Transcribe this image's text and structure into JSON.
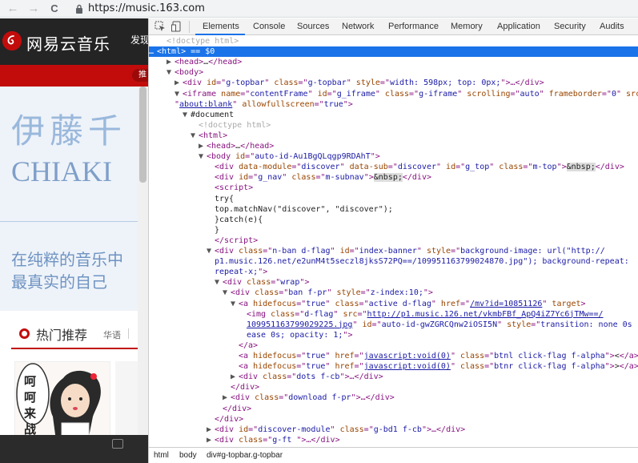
{
  "browser": {
    "url": "https://music.163.com",
    "back_icon": "←",
    "forward_icon": "→",
    "reload_icon": "C"
  },
  "site": {
    "logo_text": "网易云音乐",
    "nav_partial": "发现",
    "subnav_partial": "推",
    "banner_name": "伊藤千",
    "banner_en": "CHIAKI",
    "banner_slogan_1": "在纯粹的音乐中",
    "banner_slogan_2": "最真实的自己",
    "hot_title": "热门推荐",
    "hot_tag": "华语",
    "comic_text": "呵呵来战"
  },
  "devtools": {
    "tabs": [
      "Elements",
      "Console",
      "Sources",
      "Network",
      "Performance",
      "Memory",
      "Application",
      "Security",
      "Audits"
    ],
    "active_tab": "Elements",
    "breadcrumbs": [
      "html",
      "body",
      "div#g-topbar.g-topbar"
    ]
  },
  "dom_lines": [
    {
      "indent": 0,
      "tri": "",
      "cls": "cm",
      "text": "<!doctype html>"
    },
    {
      "indent": 0,
      "tri": "…",
      "cls": "sel",
      "text": "<html> == $0"
    },
    {
      "indent": 1,
      "tri": "▶",
      "html": "<span class='tag'>&lt;head&gt;</span><span class='txt'>…</span><span class='tag'>&lt;/head&gt;</span>"
    },
    {
      "indent": 1,
      "tri": "▼",
      "html": "<span class='tag'>&lt;body&gt;</span>"
    },
    {
      "indent": 2,
      "tri": "▶",
      "html": "<span class='tag'>&lt;div </span><span class='an'>id</span>=\"<span class='av'>g-topbar</span>\" <span class='an'>class</span>=\"<span class='av'>g-topbar</span>\" <span class='an'>style</span>=\"<span class='av'>width: 598px; top: 0px;</span>\"<span class='tag'>&gt;</span>…<span class='tag'>&lt;/div&gt;</span>"
    },
    {
      "indent": 2,
      "tri": "▼",
      "html": "<span class='tag'>&lt;iframe </span><span class='an'>name</span>=\"<span class='av'>contentFrame</span>\" <span class='an'>id</span>=\"<span class='av'>g_iframe</span>\" <span class='an'>class</span>=\"<span class='av'>g-iframe</span>\" <span class='an'>scrolling</span>=\"<span class='av'>auto</span>\" <span class='an'>frameborder</span>=\"<span class='av'>0</span>\" <span class='an'>src</span>="
    },
    {
      "indent": 0,
      "tri": "",
      "html": "\"<span class='lnk'>about:blank</span>\" <span class='an'>allowfullscreen</span>=\"<span class='av'>true</span>\"<span class='tag'>&gt;</span>"
    },
    {
      "indent": 3,
      "tri": "▼",
      "html": "<span class='txt'>#document</span>"
    },
    {
      "indent": 4,
      "tri": "",
      "cls": "cm",
      "text": "<!doctype html>"
    },
    {
      "indent": 4,
      "tri": "▼",
      "html": "<span class='tag'>&lt;html&gt;</span>"
    },
    {
      "indent": 5,
      "tri": "▶",
      "html": "<span class='tag'>&lt;head&gt;</span><span class='txt'>…</span><span class='tag'>&lt;/head&gt;</span>"
    },
    {
      "indent": 5,
      "tri": "▼",
      "html": "<span class='tag'>&lt;body </span><span class='an'>id</span>=\"<span class='av'>auto-id-Au1BgQLqgp9RDAhT</span>\"<span class='tag'>&gt;</span>"
    },
    {
      "indent": 6,
      "tri": "",
      "html": "<span class='tag'>&lt;div </span><span class='an'>data-module</span>=\"<span class='av'>discover</span>\" <span class='an'>data-sub</span>=\"<span class='av'>discover</span>\" <span class='an'>id</span>=\"<span class='av'>g_top</span>\" <span class='an'>class</span>=\"<span class='av'>m-top</span>\"<span class='tag'>&gt;</span><span class='nbsp'>&amp;nbsp;</span><span class='tag'>&lt;/div&gt;</span>"
    },
    {
      "indent": 6,
      "tri": "",
      "html": "<span class='tag'>&lt;div </span><span class='an'>id</span>=\"<span class='av'>g_nav</span>\" <span class='an'>class</span>=\"<span class='av'>m-subnav</span>\"<span class='tag'>&gt;</span><span class='nbsp'>&amp;nbsp;</span><span class='tag'>&lt;/div&gt;</span>"
    },
    {
      "indent": 6,
      "tri": "",
      "html": "<span class='tag'>&lt;script&gt;</span>"
    },
    {
      "indent": 6,
      "tri": "",
      "html": "<span class='txt'>try{</span>"
    },
    {
      "indent": 6,
      "tri": "",
      "html": "<span class='txt'>top.matchNav(\"discover\", \"discover\");</span>"
    },
    {
      "indent": 6,
      "tri": "",
      "html": "<span class='txt'>}catch(e){</span>"
    },
    {
      "indent": 6,
      "tri": "",
      "html": "<span class='txt'>}</span>"
    },
    {
      "indent": 6,
      "tri": "",
      "html": "<span class='tag'>&lt;/script&gt;</span>"
    },
    {
      "indent": 6,
      "tri": "▼",
      "html": "<span class='tag'>&lt;div </span><span class='an'>class</span>=\"<span class='av'>n-ban d-flag</span>\" <span class='an'>id</span>=\"<span class='av'>index-banner</span>\" <span class='an'>style</span>=\"<span class='av'>background-image: url(\"http://</span>"
    },
    {
      "indent": 6,
      "tri": "",
      "html": "<span class='av'>p1.music.126.net/e2unM4t5seczl8jksS72PQ==/109951163799024870.jpg\"); background-repeat:</span>"
    },
    {
      "indent": 6,
      "tri": "",
      "html": "<span class='av'>repeat-x;</span>\"<span class='tag'>&gt;</span>"
    },
    {
      "indent": 7,
      "tri": "▼",
      "html": "<span class='tag'>&lt;div </span><span class='an'>class</span>=\"<span class='av'>wrap</span>\"<span class='tag'>&gt;</span>"
    },
    {
      "indent": 8,
      "tri": "▼",
      "html": "<span class='tag'>&lt;div </span><span class='an'>class</span>=\"<span class='av'>ban f-pr</span>\" <span class='an'>style</span>=\"<span class='av'>z-index:10;</span>\"<span class='tag'>&gt;</span>"
    },
    {
      "indent": 9,
      "tri": "▼",
      "html": "<span class='tag'>&lt;a </span><span class='an'>hidefocus</span>=\"<span class='av'>true</span>\" <span class='an'>class</span>=\"<span class='av'>active d-flag</span>\" <span class='an'>href</span>=\"<span class='lnk'>/mv?id=10851126</span>\" <span class='an'>target</span><span class='tag'>&gt;</span>"
    },
    {
      "indent": 10,
      "tri": "",
      "html": "<span class='tag'>&lt;img </span><span class='an'>class</span>=\"<span class='av'>d-flag</span>\" <span class='an'>src</span>=\"<span class='lnk'>http://p1.music.126.net/vkmbFBf_ApQ4iZ7Yc6jTMw==/</span>"
    },
    {
      "indent": 10,
      "tri": "",
      "html": "<span class='lnk'>109951163799029225.jpg</span>\" <span class='an'>id</span>=\"<span class='av'>auto-id-gwZGRCQnw2iOSI5N</span>\" <span class='an'>style</span>=\"<span class='av'>transition: none 0s</span>"
    },
    {
      "indent": 10,
      "tri": "",
      "html": "<span class='av'>ease 0s; opacity: 1;</span>\"<span class='tag'>&gt;</span>"
    },
    {
      "indent": 9,
      "tri": "",
      "html": "<span class='tag'>&lt;/a&gt;</span>"
    },
    {
      "indent": 9,
      "tri": "",
      "html": "<span class='tag'>&lt;a </span><span class='an'>hidefocus</span>=\"<span class='av'>true</span>\" <span class='an'>href</span>=\"<span class='lnk'>javascript:void(0)</span>\" <span class='an'>class</span>=\"<span class='av'>btnl click-flag f-alpha</span>\"<span class='tag'>&gt;</span><span class='txt'>&lt;</span><span class='tag'>&lt;/a&gt;</span>"
    },
    {
      "indent": 9,
      "tri": "",
      "html": "<span class='tag'>&lt;a </span><span class='an'>hidefocus</span>=\"<span class='av'>true</span>\" <span class='an'>href</span>=\"<span class='lnk'>javascript:void(0)</span>\" <span class='an'>class</span>=\"<span class='av'>btnr click-flag f-alpha</span>\"<span class='tag'>&gt;</span><span class='txt'>&gt;</span><span class='tag'>&lt;/a&gt;</span>"
    },
    {
      "indent": 9,
      "tri": "▶",
      "html": "<span class='tag'>&lt;div </span><span class='an'>class</span>=\"<span class='av'>dots f-cb</span>\"<span class='tag'>&gt;</span>…<span class='tag'>&lt;/div&gt;</span>"
    },
    {
      "indent": 8,
      "tri": "",
      "html": "<span class='tag'>&lt;/div&gt;</span>"
    },
    {
      "indent": 8,
      "tri": "▶",
      "html": "<span class='tag'>&lt;div </span><span class='an'>class</span>=\"<span class='av'>download f-pr</span>\"<span class='tag'>&gt;</span>…<span class='tag'>&lt;/div&gt;</span>"
    },
    {
      "indent": 7,
      "tri": "",
      "html": "<span class='tag'>&lt;/div&gt;</span>"
    },
    {
      "indent": 6,
      "tri": "",
      "html": "<span class='tag'>&lt;/div&gt;</span>"
    },
    {
      "indent": 6,
      "tri": "▶",
      "html": "<span class='tag'>&lt;div </span><span class='an'>id</span>=\"<span class='av'>discover-module</span>\" <span class='an'>class</span>=\"<span class='av'>g-bd1 f-cb</span>\"<span class='tag'>&gt;</span>…<span class='tag'>&lt;/div&gt;</span>"
    },
    {
      "indent": 6,
      "tri": "▶",
      "html": "<span class='tag'>&lt;div </span><span class='an'>class</span>=\"<span class='av'>g-ft </span>\"<span class='tag'>&gt;</span>…<span class='tag'>&lt;/div&gt;</span>"
    }
  ]
}
